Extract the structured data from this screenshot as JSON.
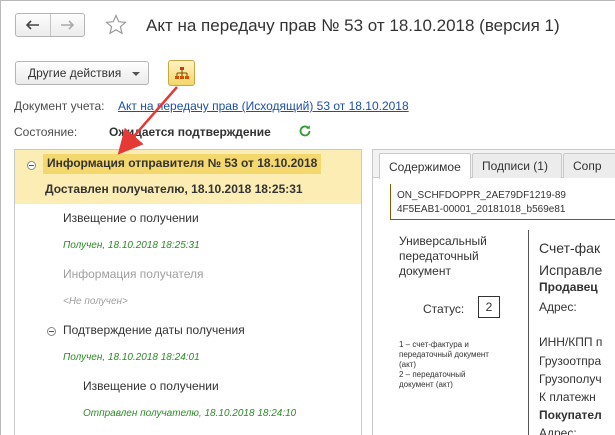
{
  "window": {
    "title": "Акт на передачу прав № 53 от 18.10.2018 (версия 1)"
  },
  "toolbar": {
    "other_actions_label": "Другие действия"
  },
  "fields": {
    "account_doc_label": "Документ учета:",
    "account_doc_link": "Акт на передачу прав (Исходящий) 53 от 18.10.2018",
    "state_label": "Состояние:",
    "state_value": "Ожидается подтверждение"
  },
  "tree": {
    "root_title": "Информация отправителя № 53 от 18.10.2018",
    "root_subtitle": "Доставлен получателю, 18.10.2018 18:25:31",
    "items": [
      {
        "label": "Извещение о получении",
        "status": "Получен, 18.10.2018 18:25:31"
      },
      {
        "label": "Информация получателя",
        "status": "<Не получен>"
      },
      {
        "label": "Подтверждение даты получения",
        "status": "Получен, 18.10.2018 18:24:01"
      },
      {
        "label": "Извещение о получении",
        "status": "Отправлен получателю, 18.10.2018 18:24:10"
      }
    ]
  },
  "right": {
    "tabs": [
      "Содержимое",
      "Подписи (1)",
      "Сопр"
    ],
    "filename_line1": "ON_SCHFDOPPR_2AE79DF1219-89",
    "filename_line2": "4F5EAB1-00001_20181018_b569e81",
    "doc_type_lines": [
      "Универсальный",
      "передаточный",
      "документ"
    ],
    "status_label": "Статус:",
    "status_value": "2",
    "notes": [
      "1 – счет-фактура и",
      "передаточный документ",
      "(акт)",
      "2 – передаточный",
      "документ (акт)"
    ],
    "right_lines": [
      {
        "text": "Счет-фак",
        "bold": false
      },
      {
        "text": "Исправле",
        "bold": false
      },
      {
        "text": "Продавец",
        "bold": true
      },
      {
        "text": "Адрес:",
        "bold": false
      },
      {
        "text": "ИНН/КПП п",
        "bold": false
      },
      {
        "text": "Грузоотпра",
        "bold": false
      },
      {
        "text": "Грузополуч",
        "bold": false
      },
      {
        "text": "К платежн",
        "bold": false
      },
      {
        "text": "Покупател",
        "bold": true
      },
      {
        "text": "Адрес:",
        "bold": false
      }
    ]
  },
  "colors": {
    "selection": "#f5d86d",
    "highlight_row": "#fcedb4",
    "link": "#1c4fa8",
    "status_green": "#2b8a25",
    "annotation_arrow": "#e53935"
  }
}
